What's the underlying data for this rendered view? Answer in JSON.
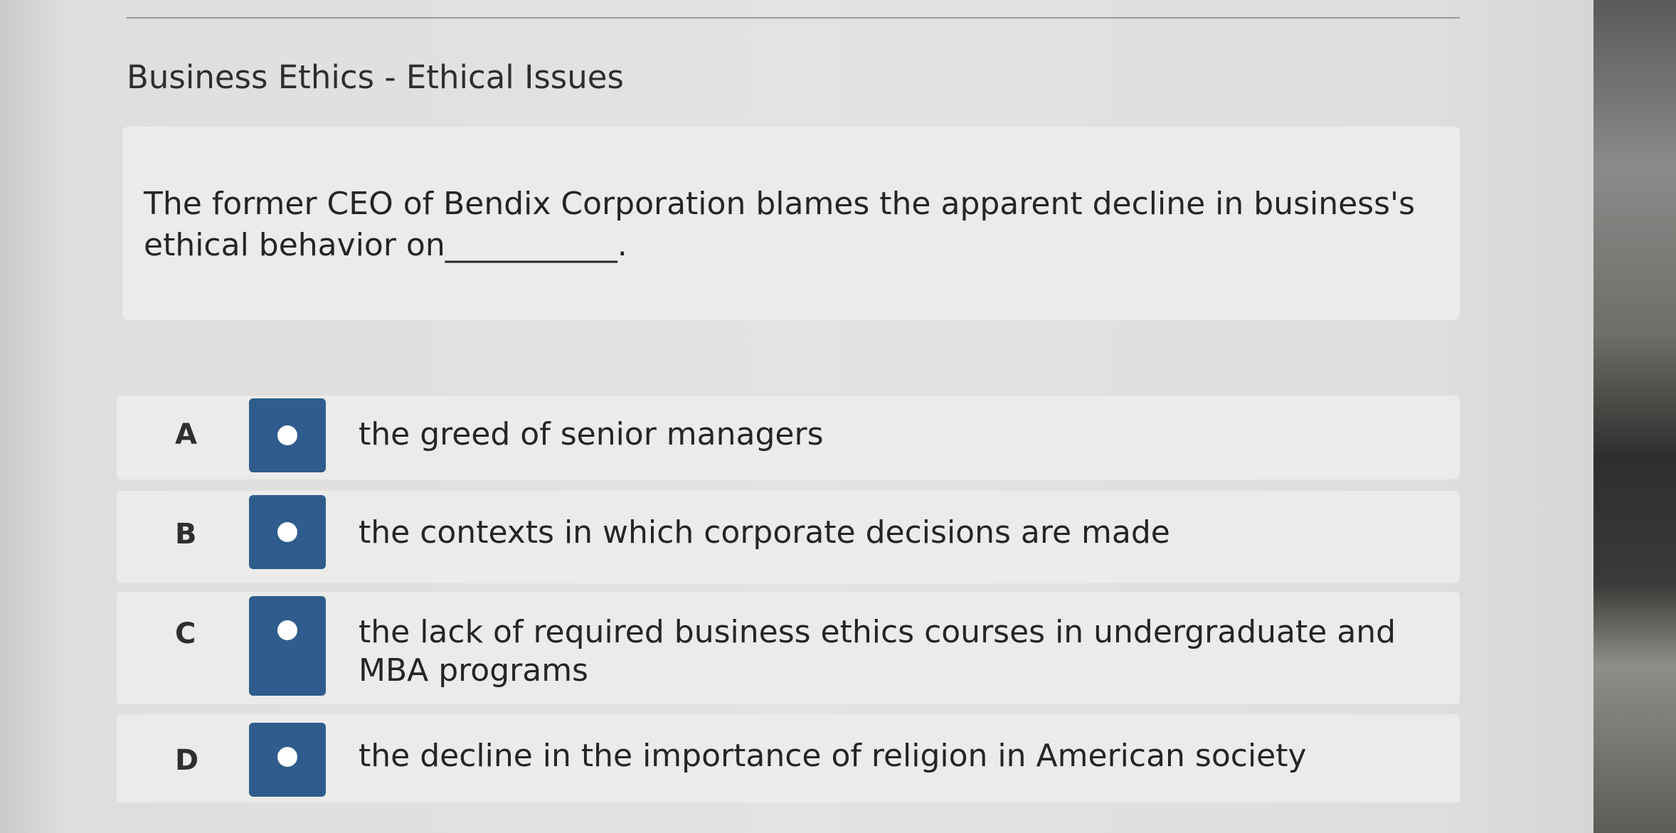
{
  "header": {
    "title": "Business Ethics - Ethical Issues"
  },
  "question": {
    "text": "The former CEO of Bendix Corporation blames the apparent decline in business's ethical behavior on___________."
  },
  "options": [
    {
      "letter": "A",
      "text": "the greed of senior managers"
    },
    {
      "letter": "B",
      "text": "the contexts in which corporate decisions are made"
    },
    {
      "letter": "C",
      "text": "the lack of required business ethics courses in undergraduate and MBA programs"
    },
    {
      "letter": "D",
      "text": "the decline in the importance of religion in American society"
    }
  ],
  "colors": {
    "radio_button": "#2f5c8c",
    "radio_dot": "#ffffff",
    "card_background": "#ebebea"
  },
  "icons": {
    "radio": "radio-unselected-icon"
  }
}
